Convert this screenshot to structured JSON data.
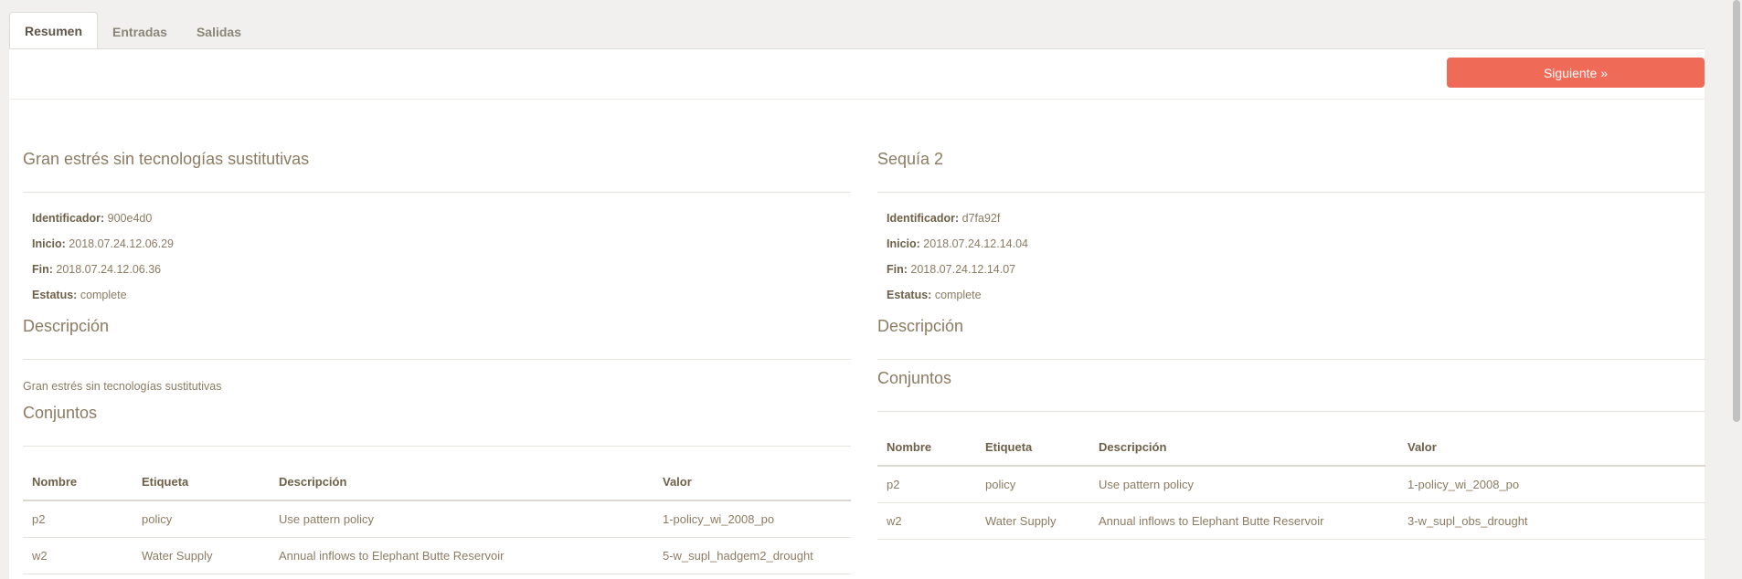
{
  "tabs": [
    "Resumen",
    "Entradas",
    "Salidas"
  ],
  "toolbar": {
    "next_label": "Siguiente »"
  },
  "runs": [
    {
      "title": "Gran estrés sin tecnologías sustitutivas",
      "meta": [
        {
          "label": "Identificador:",
          "value": "900e4d0"
        },
        {
          "label": "Inicio:",
          "value": "2018.07.24.12.06.29"
        },
        {
          "label": "Fin:",
          "value": "2018.07.24.12.06.36"
        },
        {
          "label": "Estatus:",
          "value": "complete"
        }
      ],
      "description_heading": "Descripción",
      "description": "Gran estrés sin tecnologías sustitutivas",
      "sets_heading": "Conjuntos",
      "columns": [
        "Nombre",
        "Etiqueta",
        "Descripción",
        "Valor"
      ],
      "rows": [
        [
          "p2",
          "policy",
          "Use pattern policy",
          "1-policy_wi_2008_po"
        ],
        [
          "w2",
          "Water Supply",
          "Annual inflows to Elephant Butte Reservoir",
          "5-w_supl_hadgem2_drought"
        ]
      ]
    },
    {
      "title": "Sequía 2",
      "meta": [
        {
          "label": "Identificador:",
          "value": "d7fa92f"
        },
        {
          "label": "Inicio:",
          "value": "2018.07.24.12.14.04"
        },
        {
          "label": "Fin:",
          "value": "2018.07.24.12.14.07"
        },
        {
          "label": "Estatus:",
          "value": "complete"
        }
      ],
      "description_heading": "Descripción",
      "description": "",
      "sets_heading": "Conjuntos",
      "columns": [
        "Nombre",
        "Etiqueta",
        "Descripción",
        "Valor"
      ],
      "rows": [
        [
          "p2",
          "policy",
          "Use pattern policy",
          "1-policy_wi_2008_po"
        ],
        [
          "w2",
          "Water Supply",
          "Annual inflows to Elephant Butte Reservoir",
          "3-w_supl_obs_drought"
        ]
      ]
    }
  ]
}
